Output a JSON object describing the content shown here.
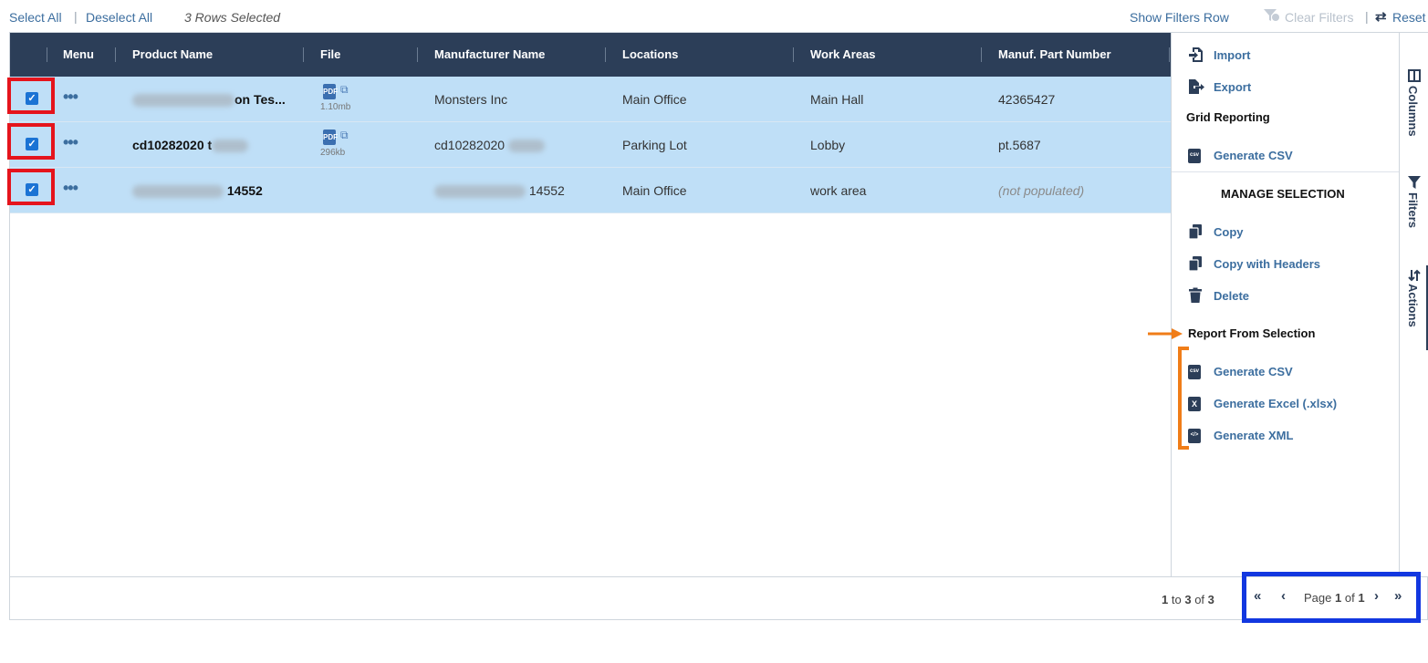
{
  "toolbar": {
    "select_all": "Select All",
    "deselect_all": "Deselect All",
    "rows_selected": "3 Rows Selected",
    "show_filters_row": "Show Filters Row",
    "clear_filters": "Clear Filters",
    "reset": "Reset"
  },
  "grid": {
    "columns": [
      "Menu",
      "Product Name",
      "File",
      "Manufacturer Name",
      "Locations",
      "Work Areas",
      "Manuf. Part Number"
    ],
    "rows": [
      {
        "product_name": "on Tes...",
        "file_size": "1.10mb",
        "manufacturer": "Monsters Inc",
        "location": "Main Office",
        "work_area": "Main Hall",
        "part_number": "42365427",
        "selected": true
      },
      {
        "product_name": "cd10282020 t",
        "file_size": "296kb",
        "manufacturer": "cd10282020",
        "location": "Parking Lot",
        "work_area": "Lobby",
        "part_number": "pt.5687",
        "selected": true
      },
      {
        "product_name": "14552",
        "file_size": "",
        "manufacturer": "14552",
        "location": "Main Office",
        "work_area": "work area",
        "part_number": "(not populated)",
        "selected": true
      }
    ]
  },
  "panel": {
    "import": "Import",
    "export": "Export",
    "grid_reporting": "Grid Reporting",
    "generate_csv": "Generate CSV",
    "manage_selection": "MANAGE SELECTION",
    "copy": "Copy",
    "copy_with_headers": "Copy with Headers",
    "delete": "Delete",
    "report_from_selection": "Report From Selection",
    "sel_generate_csv": "Generate CSV",
    "sel_generate_excel": "Generate Excel (.xlsx)",
    "sel_generate_xml": "Generate XML"
  },
  "side_tabs": {
    "columns": "Columns",
    "filters": "Filters",
    "actions": "Actions"
  },
  "footer": {
    "range_from": "1",
    "range_to_label": "to",
    "range_to": "3",
    "range_of_label": "of",
    "range_total": "3",
    "page_label": "Page",
    "page_current": "1",
    "page_of_label": "of",
    "page_total": "1"
  },
  "colors": {
    "header_bg": "#2c3e58",
    "row_selected": "#bfdff7",
    "link": "#3c6e9f",
    "highlight_red": "#e5141c",
    "highlight_orange": "#f07d18",
    "highlight_blue": "#1237e0"
  }
}
